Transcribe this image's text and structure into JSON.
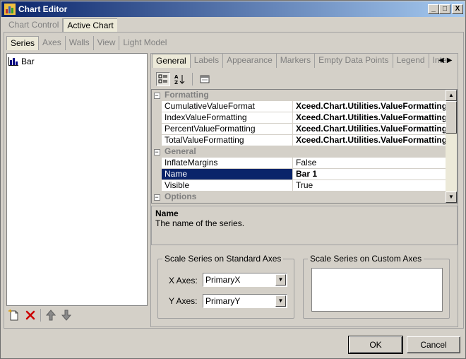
{
  "window": {
    "title": "Chart Editor",
    "controls": {
      "minimize": "_",
      "maximize": "□",
      "close": "X"
    }
  },
  "top_tabs": [
    {
      "label": "Chart Control",
      "active": false
    },
    {
      "label": "Active Chart",
      "active": true
    }
  ],
  "sub_tabs": [
    {
      "label": "Series",
      "active": true
    },
    {
      "label": "Axes",
      "active": false
    },
    {
      "label": "Walls",
      "active": false
    },
    {
      "label": "View",
      "active": false
    },
    {
      "label": "Light Model",
      "active": false
    }
  ],
  "series_list": {
    "items": [
      {
        "label": "Bar",
        "icon": "bar-chart-icon"
      }
    ],
    "toolbar_icons": [
      "new-series-icon",
      "delete-icon",
      "move-up-icon",
      "move-down-icon"
    ]
  },
  "property_tabs": [
    {
      "label": "General",
      "active": true
    },
    {
      "label": "Labels",
      "active": false
    },
    {
      "label": "Appearance",
      "active": false
    },
    {
      "label": "Markers",
      "active": false
    },
    {
      "label": "Empty Data Points",
      "active": false
    },
    {
      "label": "Legend",
      "active": false
    },
    {
      "label": "Inter",
      "active": false
    }
  ],
  "grid_toolbar_icons": [
    "categorized-icon",
    "alphabetical-icon",
    "property-pages-icon"
  ],
  "property_grid": {
    "rows": [
      {
        "type": "category",
        "name": "Formatting",
        "expander": "−"
      },
      {
        "type": "property",
        "name": "CumulativeValueFormat",
        "value": "Xceed.Chart.Utilities.ValueFormatting",
        "bold": true
      },
      {
        "type": "property",
        "name": "IndexValueFormatting",
        "value": "Xceed.Chart.Utilities.ValueFormatting",
        "bold": true
      },
      {
        "type": "property",
        "name": "PercentValueFormatting",
        "value": "Xceed.Chart.Utilities.ValueFormatting",
        "bold": true
      },
      {
        "type": "property",
        "name": "TotalValueFormatting",
        "value": "Xceed.Chart.Utilities.ValueFormatting",
        "bold": true
      },
      {
        "type": "category",
        "name": "General",
        "expander": "−"
      },
      {
        "type": "property",
        "name": "InflateMargins",
        "value": "False",
        "bold": false
      },
      {
        "type": "property",
        "name": "Name",
        "value": "Bar 1",
        "bold": false,
        "selected": true
      },
      {
        "type": "property",
        "name": "Visible",
        "value": "True",
        "bold": false
      },
      {
        "type": "category",
        "name": "Options",
        "expander": "−"
      }
    ]
  },
  "description": {
    "title": "Name",
    "text": "The name of the series."
  },
  "standard_axes": {
    "title": "Scale Series on Standard Axes",
    "x_label": "X Axes:",
    "x_value": "PrimaryX",
    "y_label": "Y Axes:",
    "y_value": "PrimaryY"
  },
  "custom_axes": {
    "title": "Scale Series on Custom Axes"
  },
  "buttons": {
    "ok": "OK",
    "cancel": "Cancel"
  },
  "colors": {
    "titlebar_start": "#0a246a",
    "titlebar_end": "#a6caf0",
    "selection": "#0a246a",
    "face": "#d4d0c8",
    "delete_red": "#cc0000"
  }
}
